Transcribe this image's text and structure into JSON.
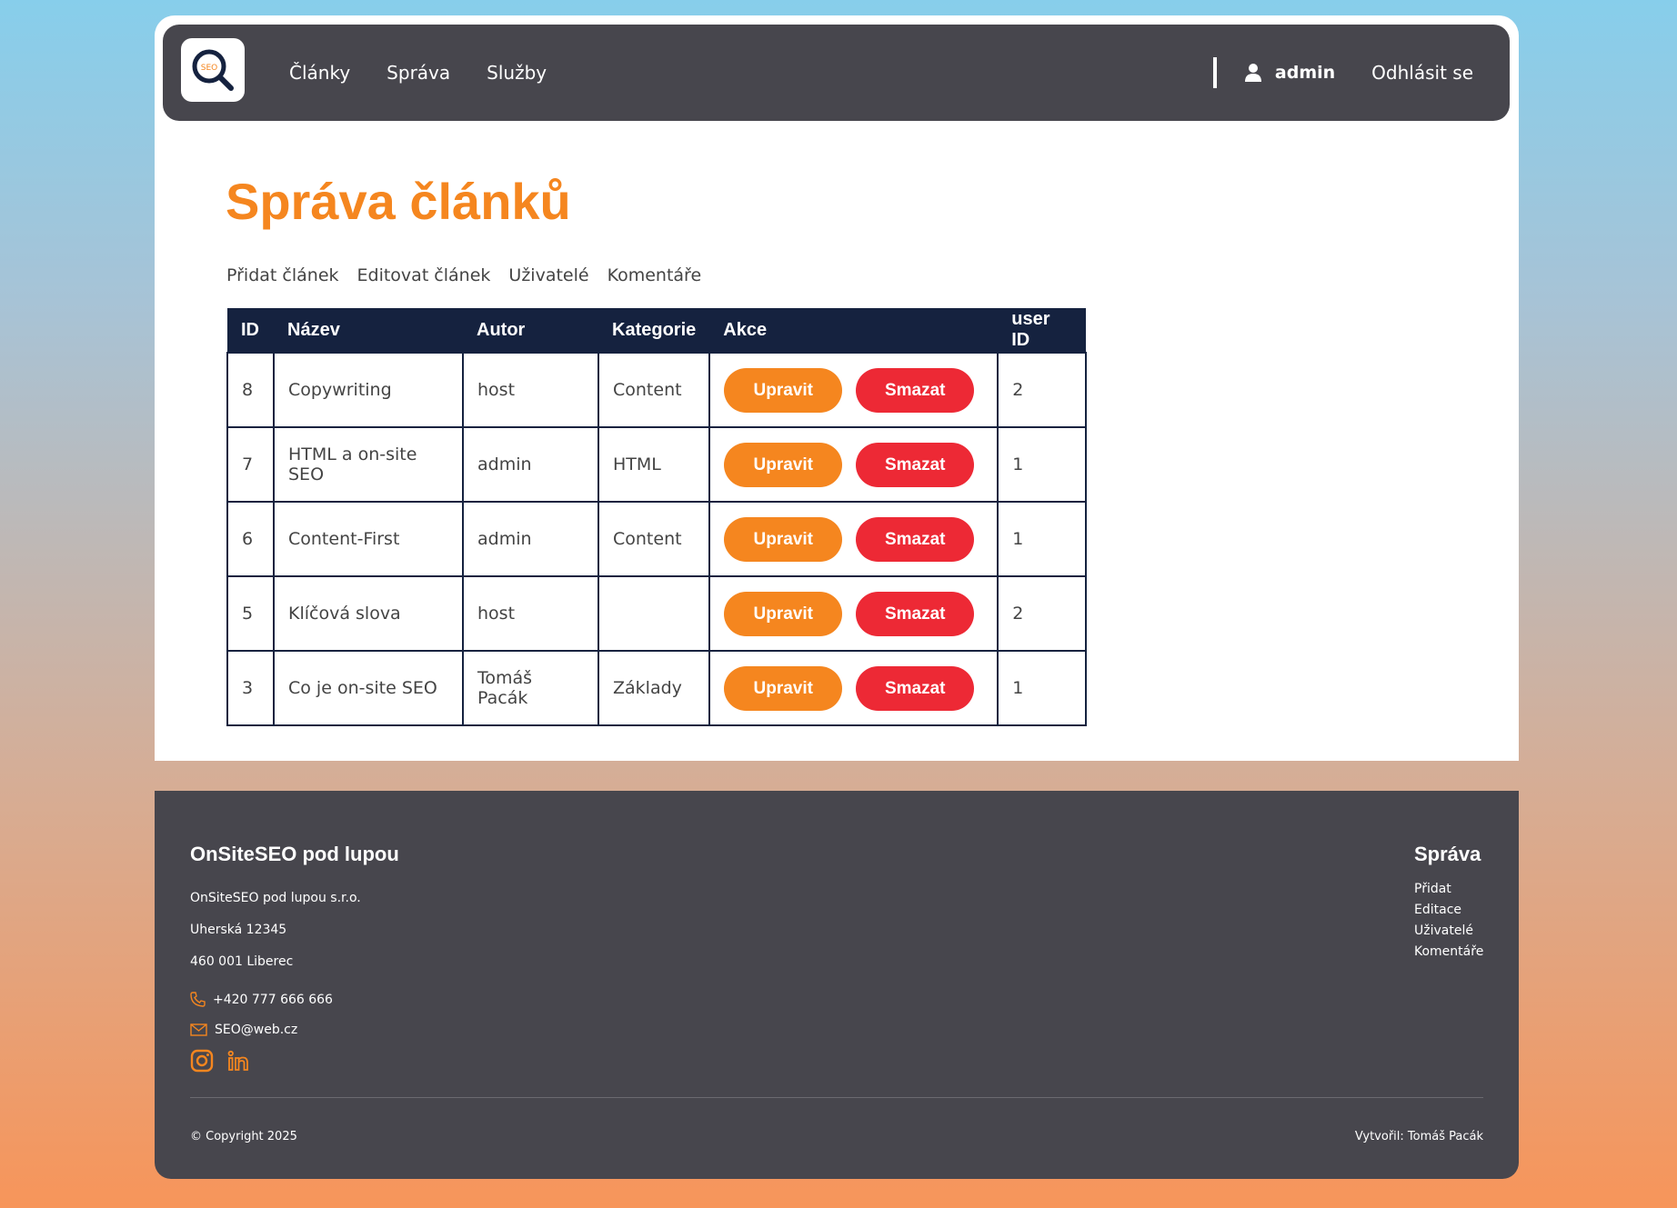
{
  "nav": {
    "logo_text": "SEO",
    "links": [
      "Články",
      "Správa",
      "Služby"
    ],
    "user": "admin",
    "logout": "Odhlásit se"
  },
  "page": {
    "title": "Správa článků",
    "subnav": [
      "Přidat článek",
      "Editovat článek",
      "Uživatelé",
      "Komentáře"
    ]
  },
  "table": {
    "headers": [
      "ID",
      "Název",
      "Autor",
      "Kategorie",
      "Akce",
      "user ID"
    ],
    "edit_label": "Upravit",
    "delete_label": "Smazat",
    "rows": [
      {
        "id": "8",
        "name": "Copywriting",
        "author": "host",
        "category": "Content",
        "user_id": "2"
      },
      {
        "id": "7",
        "name": "HTML a on-site SEO",
        "author": "admin",
        "category": "HTML",
        "user_id": "1"
      },
      {
        "id": "6",
        "name": "Content-First",
        "author": "admin",
        "category": "Content",
        "user_id": "1"
      },
      {
        "id": "5",
        "name": "Klíčová slova",
        "author": "host",
        "category": "",
        "user_id": "2"
      },
      {
        "id": "3",
        "name": "Co je on-site SEO",
        "author": "Tomáš Pacák",
        "category": "Základy",
        "user_id": "1"
      }
    ]
  },
  "footer": {
    "brand": "OnSiteSEO pod lupou",
    "company": "OnSiteSEO pod lupou s.r.o.",
    "street": "Uherská 12345",
    "city": "460 001 Liberec",
    "phone": "+420 777 666 666",
    "email": "SEO@web.cz",
    "admin_title": "Správa",
    "admin_links": [
      "Přidat",
      "Editace",
      "Uživatelé",
      "Komentáře"
    ],
    "copyright": "© Copyright 2025",
    "author": "Vytvořil: Tomáš Pacák"
  },
  "colors": {
    "accent": "#f5861f",
    "danger": "#ed2935",
    "navy": "#15223f",
    "dark": "#47464d"
  }
}
